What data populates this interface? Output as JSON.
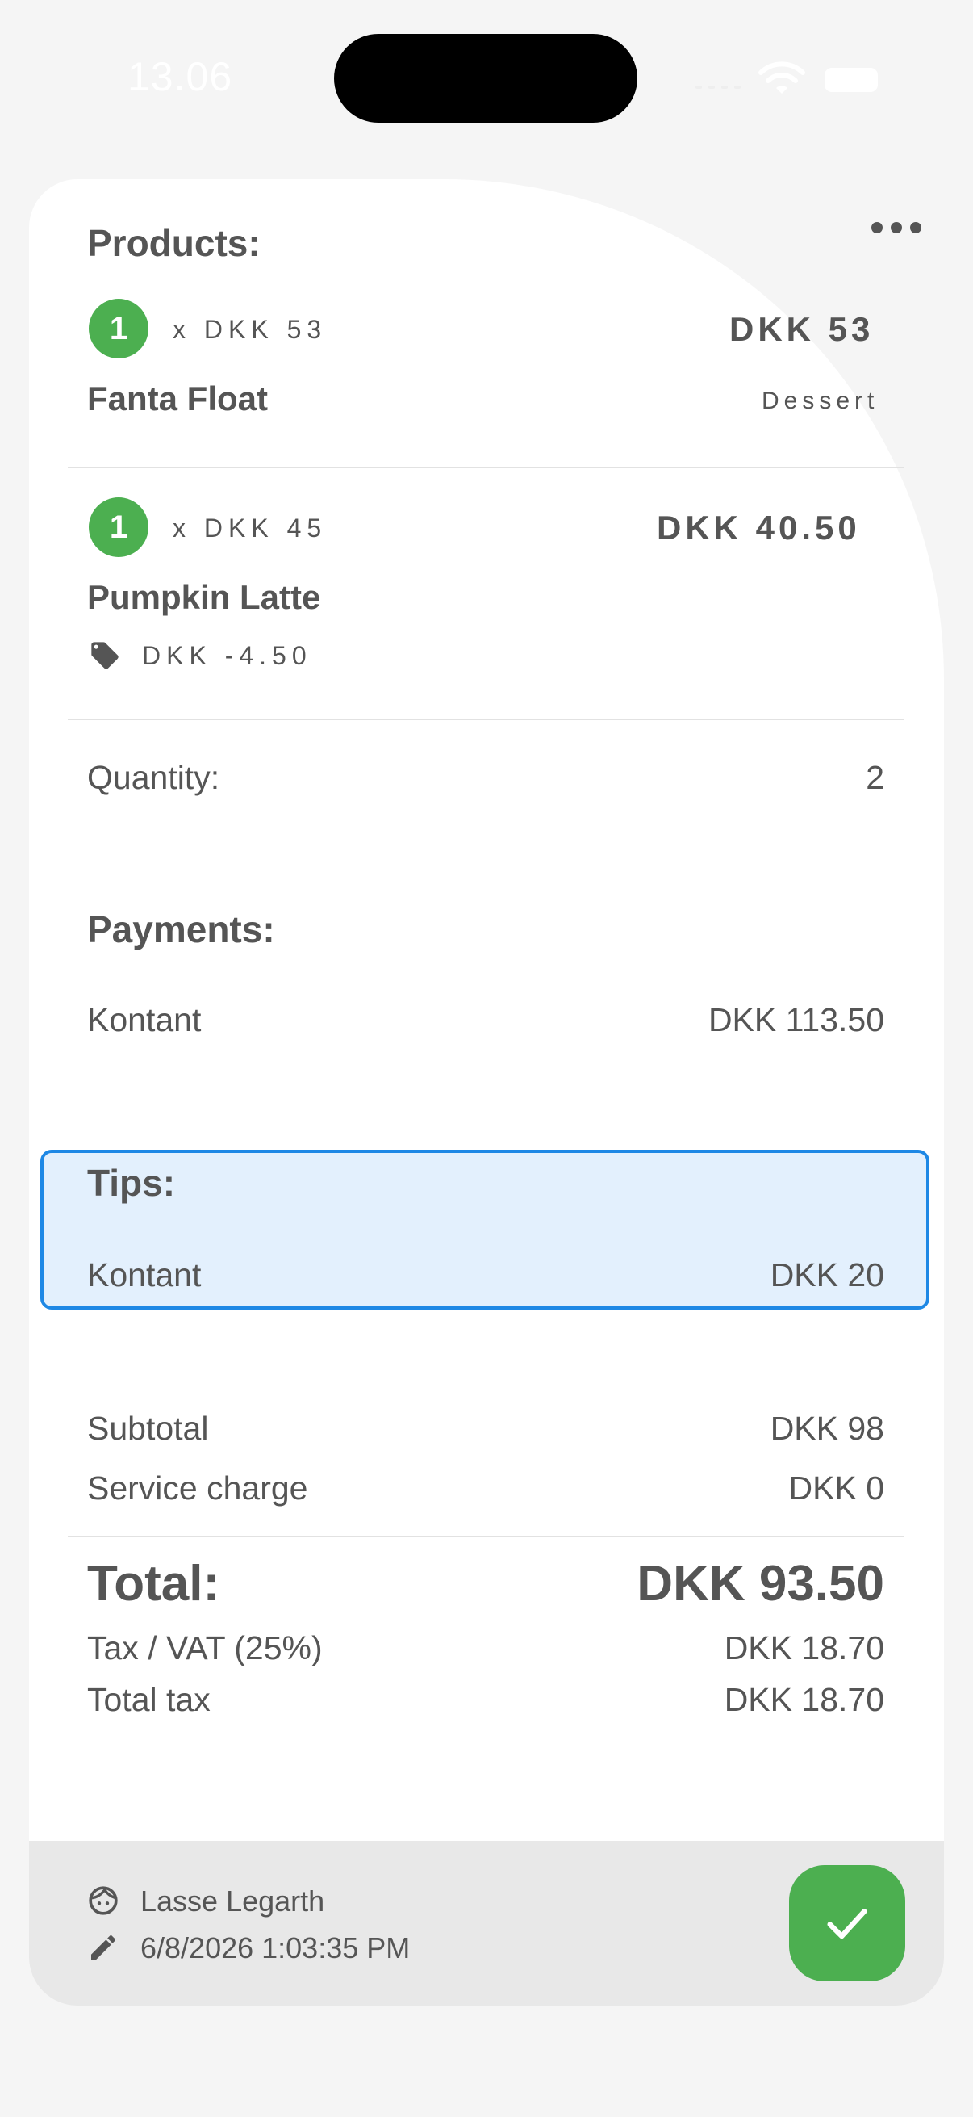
{
  "status_bar": {
    "time": "13.06"
  },
  "products": {
    "title": "Products:",
    "items": [
      {
        "qty": "1",
        "unit_price": "x DKK 53",
        "line_total": "DKK 53",
        "name": "Fanta Float",
        "category": "Dessert"
      },
      {
        "qty": "1",
        "unit_price": "x DKK 45",
        "line_total": "DKK 40.50",
        "name": "Pumpkin Latte",
        "discount": "DKK -4.50"
      }
    ]
  },
  "quantity": {
    "label": "Quantity:",
    "value": "2"
  },
  "payments": {
    "title": "Payments:",
    "method": "Kontant",
    "amount": "DKK 113.50"
  },
  "tips": {
    "title": "Tips:",
    "method": "Kontant",
    "amount": "DKK 20"
  },
  "summary": {
    "subtotal_label": "Subtotal",
    "subtotal_value": "DKK 98",
    "service_label": "Service charge",
    "service_value": "DKK 0",
    "total_label": "Total:",
    "total_value": "DKK 93.50",
    "vat_label": "Tax / VAT (25%)",
    "vat_value": "DKK 18.70",
    "total_tax_label": "Total tax",
    "total_tax_value": "DKK 18.70"
  },
  "footer": {
    "user": "Lasse Legarth",
    "timestamp": "6/8/2026 1:03:35 PM"
  },
  "icons": {
    "more": "more-horizontal-icon",
    "tag": "tag-icon",
    "user": "face-icon",
    "edit": "pencil-icon",
    "confirm": "check-icon"
  },
  "colors": {
    "accent_green": "#4caf50",
    "tips_border": "#1e88e5",
    "tips_bg": "#e3f0fd",
    "text": "#555555"
  }
}
